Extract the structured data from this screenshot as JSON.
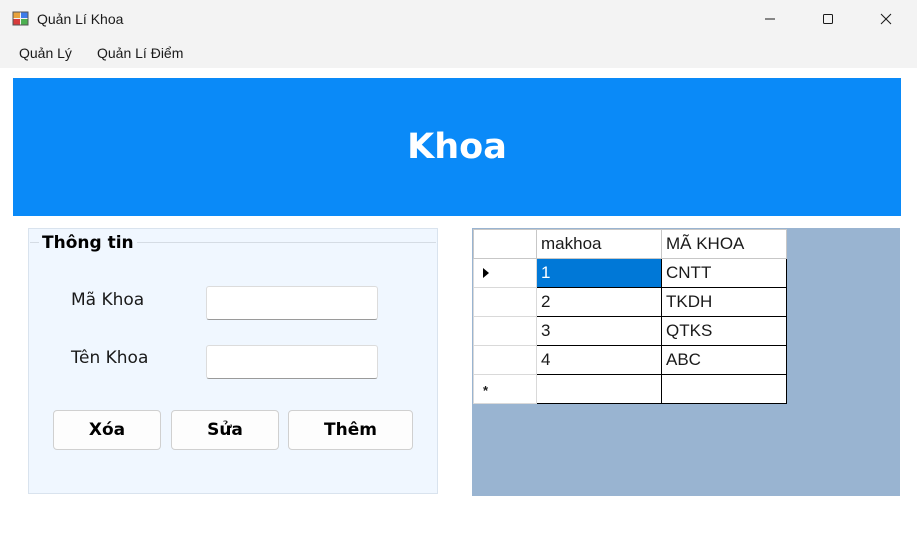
{
  "window": {
    "title": "Quản Lí Khoa"
  },
  "menu": {
    "items": [
      "Quản Lý",
      "Quản Lí Điểm"
    ]
  },
  "banner": {
    "title": "Khoa",
    "color": "#0a8af8"
  },
  "info_group": {
    "title": "Thông tin",
    "fields": [
      {
        "label": "Mã Khoa",
        "value": ""
      },
      {
        "label": "Tên Khoa",
        "value": ""
      }
    ],
    "buttons": {
      "delete": "Xóa",
      "edit": "Sửa",
      "add": "Thêm"
    }
  },
  "grid": {
    "columns": [
      "makhoa",
      "MÃ KHOA"
    ],
    "rows": [
      [
        "1",
        "CNTT"
      ],
      [
        "2",
        "TKDH"
      ],
      [
        "3",
        "QTKS"
      ],
      [
        "4",
        "ABC"
      ]
    ],
    "new_row_marker": "*",
    "background_color": "#99b4d1",
    "selection_color": "#0078d7"
  },
  "icons": {
    "app": "app-icon",
    "minimize": "minimize-icon",
    "maximize": "maximize-icon",
    "close": "close-icon",
    "current_row": "current-row-arrow-icon"
  }
}
